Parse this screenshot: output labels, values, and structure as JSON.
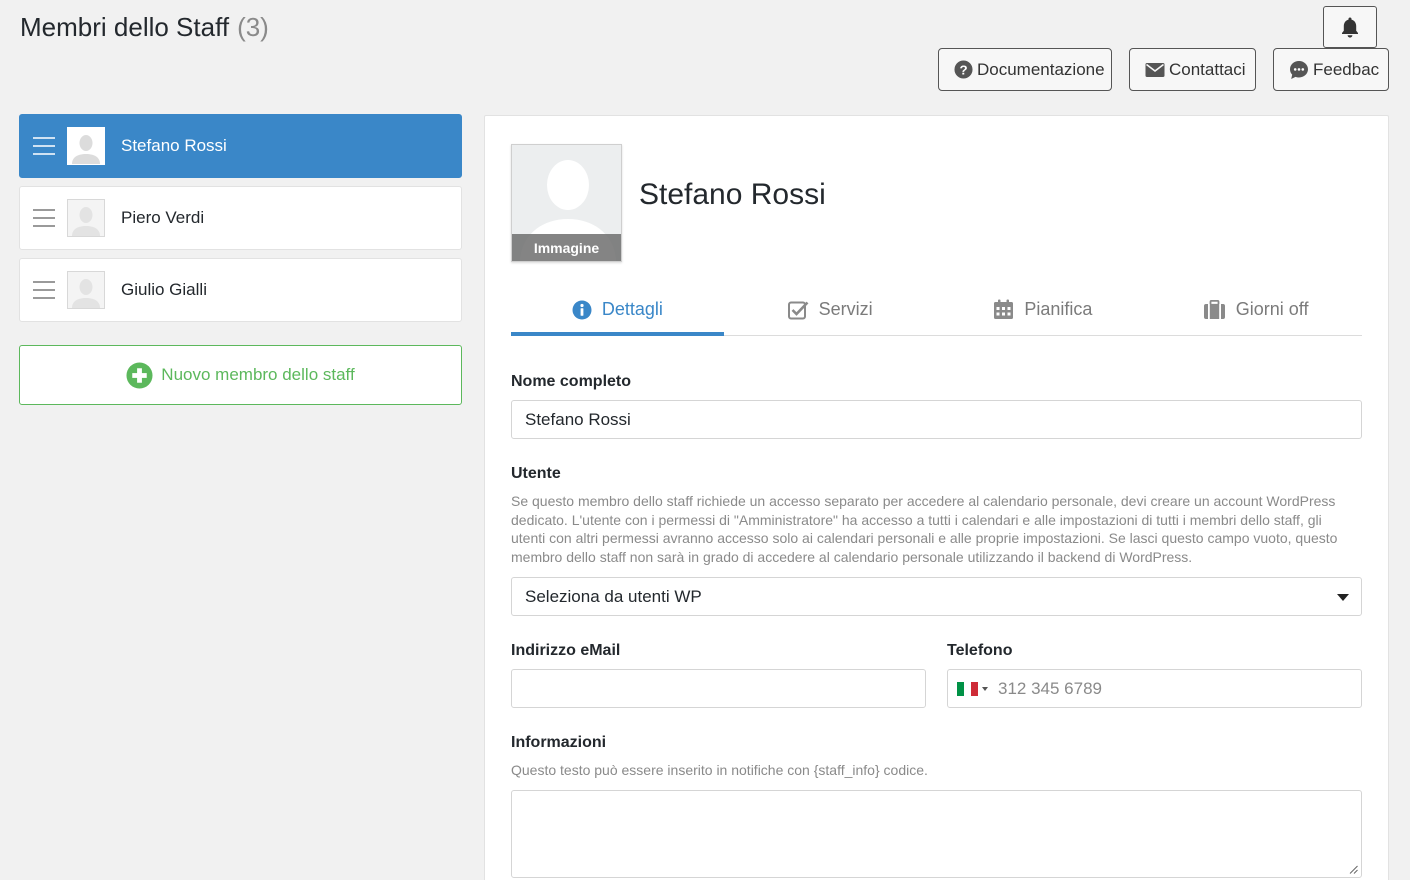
{
  "header": {
    "title": "Membri dello Staff",
    "count": "(3)",
    "buttons": {
      "docs": "Documentazione",
      "contact": "Contattaci",
      "feedback": "Feedbac"
    }
  },
  "staff": [
    {
      "name": "Stefano Rossi",
      "active": true
    },
    {
      "name": "Piero Verdi",
      "active": false
    },
    {
      "name": "Giulio Gialli",
      "active": false
    }
  ],
  "new_staff_label": "Nuovo membro dello staff",
  "profile": {
    "name": "Stefano Rossi",
    "image_label": "Immagine"
  },
  "tabs": [
    {
      "label": "Dettagli",
      "icon": "info-icon",
      "active": true
    },
    {
      "label": "Servizi",
      "icon": "checkbox-icon",
      "active": false
    },
    {
      "label": "Pianifica",
      "icon": "calendar-icon",
      "active": false
    },
    {
      "label": "Giorni off",
      "icon": "suitcase-icon",
      "active": false
    }
  ],
  "form": {
    "full_name": {
      "label": "Nome completo",
      "value": "Stefano Rossi"
    },
    "user": {
      "label": "Utente",
      "help": "Se questo membro dello staff richiede un accesso separato per accedere al calendario personale, devi creare un account WordPress dedicato. L'utente con i permessi di \"Amministratore\" ha accesso a tutti i calendari e alle impostazioni di tutti i membri dello staff, gli utenti con altri permessi avranno accesso solo ai calendari personali e alle proprie impostazioni. Se lasci questo campo vuoto, questo membro dello staff non sarà in grado di accedere al calendario personale utilizzando il backend di WordPress.",
      "selected": "Seleziona da utenti WP"
    },
    "email": {
      "label": "Indirizzo eMail",
      "value": ""
    },
    "phone": {
      "label": "Telefono",
      "placeholder": "312 345 6789"
    },
    "info": {
      "label": "Informazioni",
      "help": "Questo testo può essere inserito in notifiche con {staff_info} codice.",
      "value": ""
    }
  },
  "colors": {
    "accent": "#3a87c8",
    "success": "#5cb85c",
    "flag_green": "#009246",
    "flag_white": "#ffffff",
    "flag_red": "#ce2b37"
  }
}
